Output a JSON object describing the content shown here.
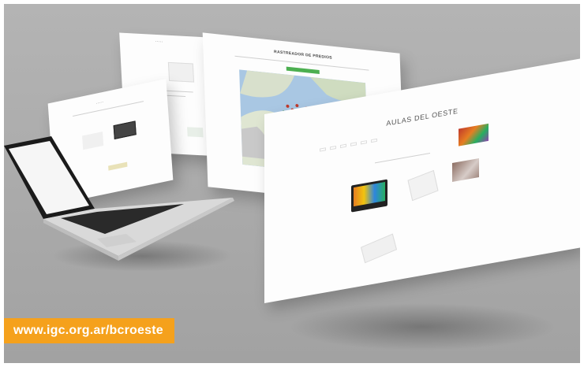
{
  "banner": {
    "url_text": "www.igc.org.ar/bcroeste"
  },
  "main_page": {
    "title": "AULAS DEL OESTE",
    "nav": [
      "",
      "",
      "",
      "",
      "",
      ""
    ],
    "cards": [
      {
        "label": "",
        "sub": ""
      },
      {
        "label": "",
        "sub": ""
      },
      {
        "label": "",
        "sub": ""
      },
      {
        "label": "",
        "sub": ""
      }
    ]
  },
  "map_page": {
    "title": "RASTREADOR DE PREDIOS"
  },
  "colors": {
    "banner": "#f5a11c",
    "background": "#aaaaaa",
    "accent_green": "#4caf50"
  }
}
